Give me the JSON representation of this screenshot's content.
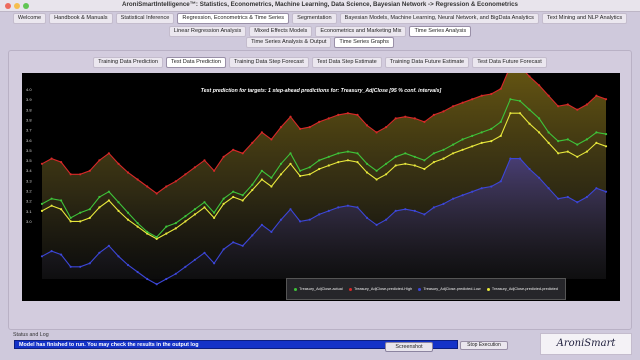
{
  "window": {
    "title": "AroniSmartIntelligence™: Statistics, Econometrics, Machine Learning, Data Science, Bayesian Network  -> Regression & Econometrics"
  },
  "main_tabs": [
    {
      "label": "Welcome",
      "selected": false
    },
    {
      "label": "Handbook & Manuals",
      "selected": false
    },
    {
      "label": "Statistical Inference",
      "selected": false
    },
    {
      "label": "Regression, Econometrics & Time Series",
      "selected": true
    },
    {
      "label": "Segmentation",
      "selected": false
    },
    {
      "label": "Bayesian Models, Machine Learning, Neural Network, and BigData Analytics",
      "selected": false
    },
    {
      "label": "Text Mining and NLP Analytics",
      "selected": false
    }
  ],
  "sub_tabs": [
    {
      "label": "Linear Regression Analysis",
      "selected": false
    },
    {
      "label": "Mixed Effects Models",
      "selected": false
    },
    {
      "label": "Econometrics and Marketing Mix",
      "selected": false
    },
    {
      "label": "Time Series Analysis",
      "selected": true
    }
  ],
  "ts_tabs": [
    {
      "label": "Time Series Analysis & Output",
      "selected": false
    },
    {
      "label": "Time Series Graphs",
      "selected": true
    }
  ],
  "graph_tabs": [
    {
      "label": "Training Data Prediction",
      "selected": false
    },
    {
      "label": "Test Data Prediction",
      "selected": true
    },
    {
      "label": "Training Data Step Forecast",
      "selected": false
    },
    {
      "label": "Test  Data Step Estimate",
      "selected": false
    },
    {
      "label": "Training Data Future Estimate",
      "selected": false
    },
    {
      "label": "Test  Data Future Forecast",
      "selected": false
    }
  ],
  "chart_data": {
    "type": "line",
    "title": "Test prediction for targets: 1  step-ahead predictions for: Treasury_AdjClose [95 % conf. intervals]",
    "ylim": [
      3.0,
      4.1
    ],
    "y_ticks": [
      "4.0",
      "3.9",
      "3.8",
      "3.8",
      "3.7",
      "3.6",
      "3.5",
      "3.5",
      "3.4",
      "3.3",
      "3.2",
      "3.2",
      "3.1",
      "3.0"
    ],
    "n_points": 60,
    "series": [
      {
        "name": "Treasury_AdjClose-actual",
        "color": "#3ec43a",
        "values": [
          3.43,
          3.46,
          3.45,
          3.35,
          3.38,
          3.4,
          3.47,
          3.5,
          3.44,
          3.38,
          3.32,
          3.27,
          3.24,
          3.3,
          3.32,
          3.36,
          3.4,
          3.44,
          3.38,
          3.46,
          3.5,
          3.48,
          3.54,
          3.62,
          3.58,
          3.66,
          3.72,
          3.62,
          3.64,
          3.68,
          3.7,
          3.72,
          3.73,
          3.72,
          3.66,
          3.62,
          3.66,
          3.7,
          3.72,
          3.7,
          3.68,
          3.72,
          3.74,
          3.77,
          3.8,
          3.82,
          3.84,
          3.86,
          3.9,
          4.03,
          4.02,
          3.97,
          3.92,
          3.84,
          3.79,
          3.8,
          3.77,
          3.8,
          3.84,
          3.83
        ]
      },
      {
        "name": "Treasury_AdjClose-predicted-High",
        "color": "#d82828",
        "values": [
          3.66,
          3.69,
          3.67,
          3.6,
          3.6,
          3.62,
          3.68,
          3.72,
          3.66,
          3.61,
          3.57,
          3.53,
          3.49,
          3.53,
          3.56,
          3.6,
          3.64,
          3.68,
          3.62,
          3.7,
          3.74,
          3.72,
          3.78,
          3.84,
          3.8,
          3.87,
          3.93,
          3.86,
          3.87,
          3.9,
          3.92,
          3.94,
          3.95,
          3.94,
          3.88,
          3.84,
          3.87,
          3.92,
          3.93,
          3.92,
          3.9,
          3.94,
          3.96,
          3.99,
          4.01,
          4.03,
          4.05,
          4.06,
          4.09,
          4.22,
          4.22,
          4.16,
          4.11,
          4.05,
          3.99,
          4.0,
          3.97,
          4.0,
          4.05,
          4.03
        ]
      },
      {
        "name": "Treasury_AdjClose-predicted-Low",
        "color": "#3c46d8",
        "values": [
          3.13,
          3.16,
          3.14,
          3.07,
          3.07,
          3.09,
          3.15,
          3.19,
          3.13,
          3.08,
          3.04,
          3.0,
          2.97,
          3.0,
          3.03,
          3.07,
          3.11,
          3.15,
          3.09,
          3.17,
          3.21,
          3.19,
          3.25,
          3.31,
          3.27,
          3.34,
          3.4,
          3.33,
          3.34,
          3.37,
          3.39,
          3.41,
          3.42,
          3.41,
          3.35,
          3.31,
          3.34,
          3.39,
          3.4,
          3.39,
          3.37,
          3.41,
          3.43,
          3.46,
          3.48,
          3.5,
          3.52,
          3.53,
          3.56,
          3.69,
          3.69,
          3.63,
          3.58,
          3.52,
          3.46,
          3.47,
          3.44,
          3.47,
          3.52,
          3.5
        ]
      },
      {
        "name": "Treasury_AdjClose-predicted-predicted",
        "color": "#e8e83c",
        "values": [
          3.39,
          3.42,
          3.4,
          3.33,
          3.33,
          3.35,
          3.41,
          3.45,
          3.39,
          3.34,
          3.3,
          3.26,
          3.23,
          3.26,
          3.29,
          3.33,
          3.37,
          3.41,
          3.35,
          3.43,
          3.47,
          3.45,
          3.51,
          3.57,
          3.53,
          3.6,
          3.66,
          3.59,
          3.6,
          3.63,
          3.65,
          3.67,
          3.68,
          3.67,
          3.61,
          3.57,
          3.6,
          3.65,
          3.66,
          3.65,
          3.63,
          3.67,
          3.69,
          3.72,
          3.74,
          3.76,
          3.78,
          3.79,
          3.82,
          3.95,
          3.95,
          3.89,
          3.84,
          3.78,
          3.72,
          3.73,
          3.7,
          3.73,
          3.78,
          3.76
        ]
      }
    ],
    "legend_position": "bottom-right",
    "grid": false
  },
  "status": {
    "label": "Status and Log",
    "message": "Model has finished to run. You may check the results in the output log"
  },
  "buttons": {
    "screenshot": "Screenshot",
    "stop": "Stop Execution"
  },
  "logo": {
    "text": "AroniSmart"
  }
}
